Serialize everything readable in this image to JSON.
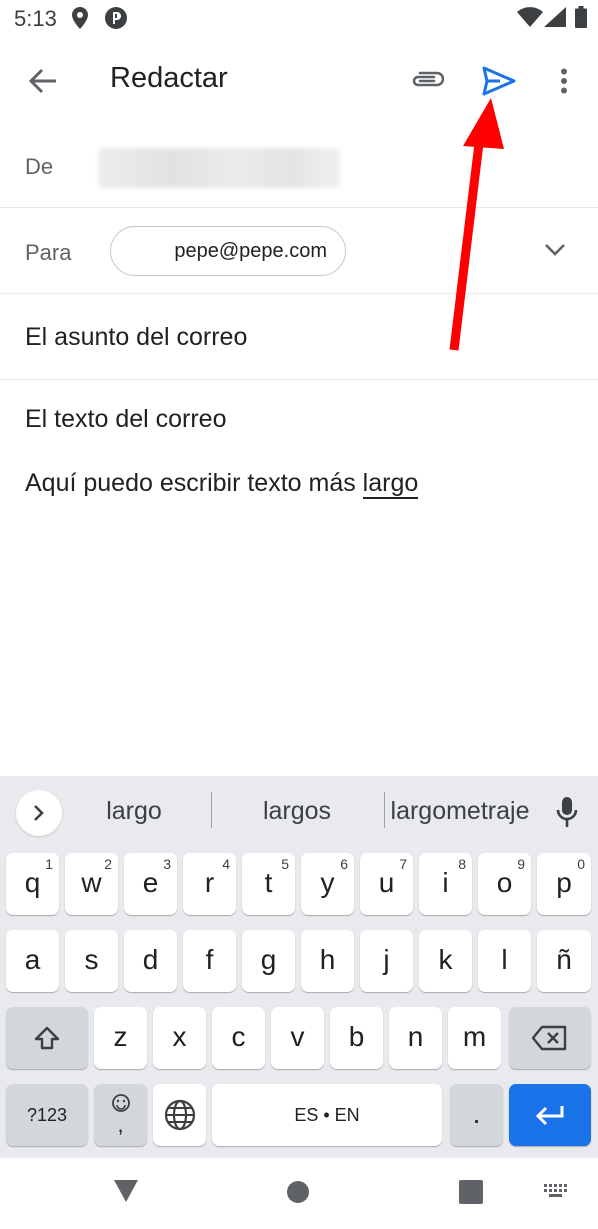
{
  "status_bar": {
    "time": "5:13"
  },
  "app_bar": {
    "title": "Redactar"
  },
  "compose": {
    "from_label": "De",
    "to_label": "Para",
    "to_chip": "pepe@pepe.com",
    "subject": "El asunto del correo",
    "body_line1": "El texto del correo",
    "body_line2_prefix": "Aquí puedo escribir texto más ",
    "body_line2_word": "largo"
  },
  "keyboard": {
    "suggestions": [
      "largo",
      "largos",
      "largometraje"
    ],
    "row1": [
      {
        "char": "q",
        "num": "1"
      },
      {
        "char": "w",
        "num": "2"
      },
      {
        "char": "e",
        "num": "3"
      },
      {
        "char": "r",
        "num": "4"
      },
      {
        "char": "t",
        "num": "5"
      },
      {
        "char": "y",
        "num": "6"
      },
      {
        "char": "u",
        "num": "7"
      },
      {
        "char": "i",
        "num": "8"
      },
      {
        "char": "o",
        "num": "9"
      },
      {
        "char": "p",
        "num": "0"
      }
    ],
    "row2": [
      "a",
      "s",
      "d",
      "f",
      "g",
      "h",
      "j",
      "k",
      "l",
      "ñ"
    ],
    "row3": [
      "z",
      "x",
      "c",
      "v",
      "b",
      "n",
      "m"
    ],
    "symbols_label": "?123",
    "emoji_label": ",",
    "space_label": "ES • EN",
    "period_label": ".",
    "colors": {
      "enter": "#1a73e8",
      "send_icon": "#1a73e8",
      "arrow": "#ff0000"
    }
  },
  "icons": [
    "back-arrow-icon",
    "attach-icon",
    "send-icon",
    "more-vert-icon",
    "chevron-down-icon",
    "chevron-right-icon",
    "mic-icon",
    "shift-icon",
    "backspace-icon",
    "emoji-icon",
    "globe-icon",
    "enter-icon"
  ]
}
